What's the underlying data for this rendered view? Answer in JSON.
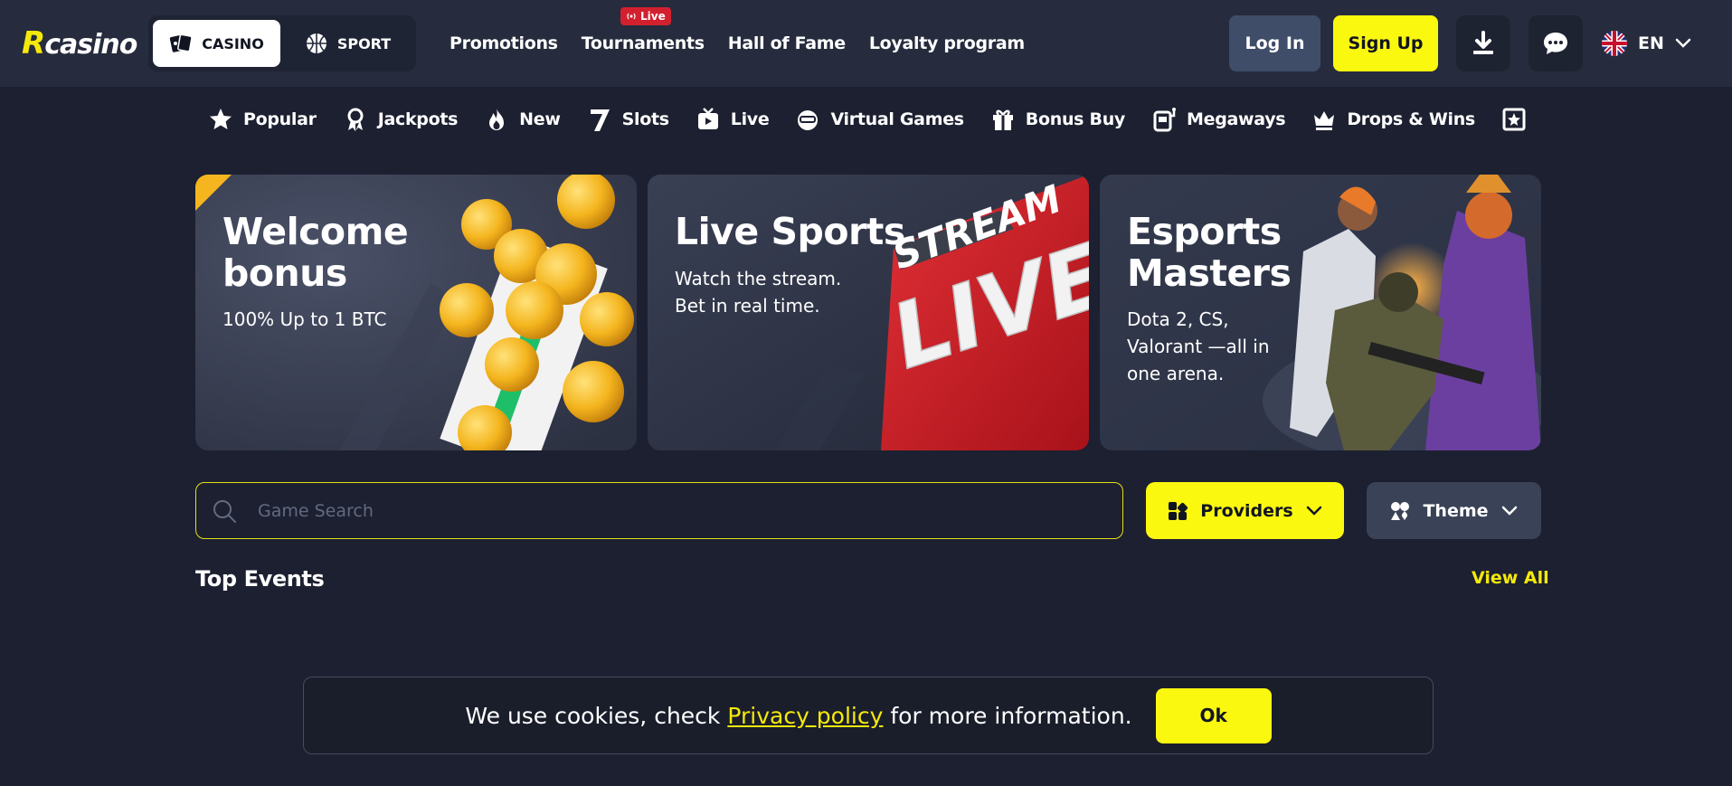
{
  "header": {
    "logo_r": "R",
    "logo_rest": "casino",
    "modes": {
      "casino": "CASINO",
      "sport": "SPORT"
    },
    "nav": [
      "Promotions",
      "Tournaments",
      "Hall of Fame",
      "Loyalty program"
    ],
    "live_badge": "Live",
    "login": "Log In",
    "signup": "Sign Up",
    "language": "EN"
  },
  "categories": [
    "Popular",
    "Jackpots",
    "New",
    "Slots",
    "Live",
    "Virtual Games",
    "Bonus Buy",
    "Megaways",
    "Drops & Wins"
  ],
  "banners": [
    {
      "title_line1": "Welcome",
      "title_line2": "bonus",
      "text": "100% Up to 1 BTC"
    },
    {
      "title_line1": "Live Sports",
      "text_line1": "Watch the stream.",
      "text_line2": "Bet in real time.",
      "art_top": "STREAM",
      "art_main": "LIVE"
    },
    {
      "title_line1": "Esports",
      "title_line2": "Masters",
      "text_line1": "Dota 2, CS,",
      "text_line2": "Valorant —all in",
      "text_line3": "one arena."
    }
  ],
  "search": {
    "placeholder": "Game Search"
  },
  "filters": {
    "providers": "Providers",
    "theme": "Theme"
  },
  "section": {
    "title": "Top Events",
    "view_all": "View All"
  },
  "cookie": {
    "text_before": "We use cookies, check ",
    "link": "Privacy policy",
    "text_after": " for more information.",
    "ok": "Ok"
  },
  "colors": {
    "accent": "#fbf80f",
    "background": "#1c2030",
    "header": "#262c3d",
    "login": "#3f4d69",
    "live": "#d3202e"
  }
}
